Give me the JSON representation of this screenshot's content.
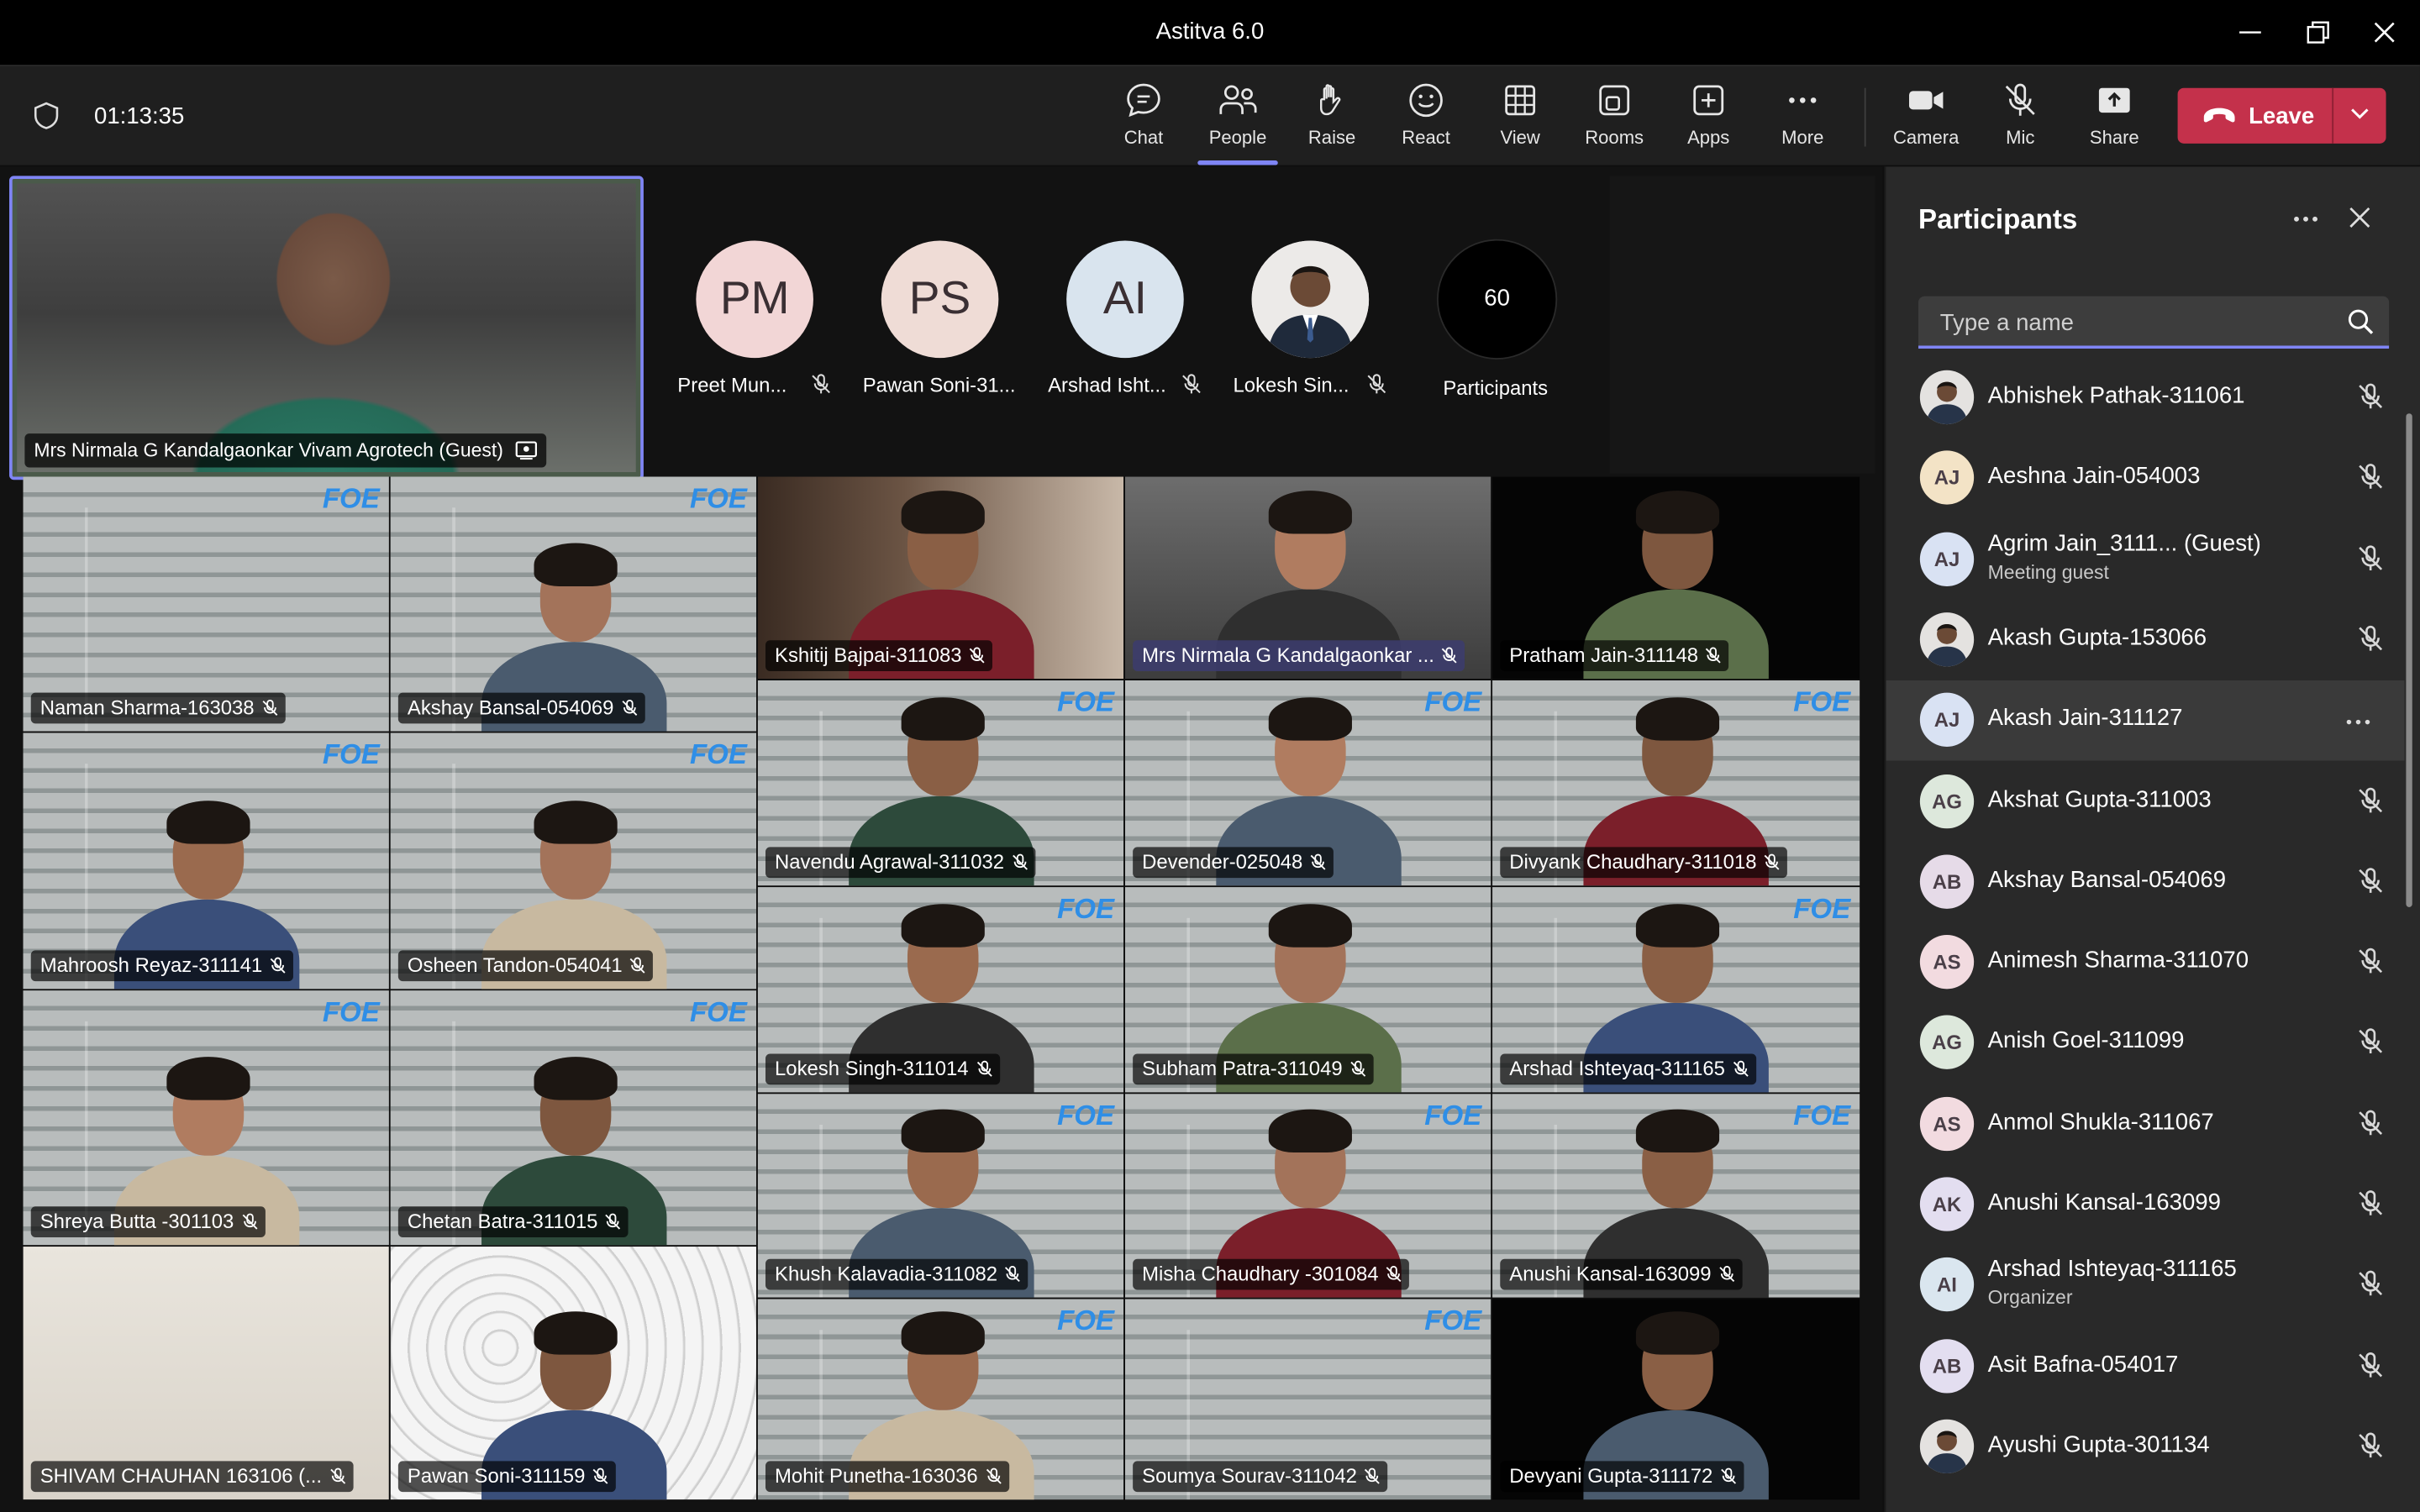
{
  "window": {
    "title": "Astitva 6.0"
  },
  "toolbar": {
    "timer": "01:13:35",
    "buttons": [
      {
        "label": "Chat",
        "icon": "chat-icon"
      },
      {
        "label": "People",
        "icon": "people-icon",
        "active": true
      },
      {
        "label": "Raise",
        "icon": "raise-hand-icon"
      },
      {
        "label": "React",
        "icon": "smile-icon"
      },
      {
        "label": "View",
        "icon": "grid-icon"
      },
      {
        "label": "Rooms",
        "icon": "rooms-icon"
      },
      {
        "label": "Apps",
        "icon": "add-square-icon"
      },
      {
        "label": "More",
        "icon": "ellipsis-icon"
      },
      {
        "label": "Camera",
        "icon": "camera-icon"
      },
      {
        "label": "Mic",
        "icon": "mic-off-icon"
      },
      {
        "label": "Share",
        "icon": "share-icon"
      }
    ],
    "leave_label": "Leave",
    "leave_color": "#c4314b",
    "accent": "#7f85f5"
  },
  "stage": {
    "featured_name": "Mrs Nirmala G Kandalgaonkar Vivam Agrotech (Guest)",
    "strip": [
      {
        "initials": "PM",
        "name": "Preet Mun...",
        "color": "#f2d6d6"
      },
      {
        "initials": "PS",
        "name": "Pawan Soni-31...",
        "color": "#efdcd6"
      },
      {
        "initials": "AI",
        "name": "Arshad Isht...",
        "color": "#d9e4ee"
      },
      {
        "initials": "",
        "name": "Lokesh Sin...",
        "color": "#e8e8e8"
      }
    ],
    "participant_count": "60",
    "participant_label": "Participants",
    "tiles": [
      "Naman Sharma-163038",
      "Akshay Bansal-054069",
      "Kshitij Bajpai-311083",
      "Mrs Nirmala G Kandalgaonkar ...",
      "Pratham Jain-311148",
      "Mahroosh Reyaz-311141",
      "Osheen Tandon-054041",
      "Navendu Agrawal-311032",
      "Devender-025048",
      "Divyank Chaudhary-311018",
      "Lokesh Singh-311014",
      "Subham Patra-311049",
      "Arshad Ishteyaq-311165",
      "Shreya Butta -301103",
      "Chetan Batra-311015",
      "Khush Kalavadia-311082",
      "Misha Chaudhary -301084",
      "Anushi Kansal-163099",
      "SHIVAM CHAUHAN 163106 (...",
      "Pawan Soni-311159",
      "Mohit Punetha-163036",
      "Soumya Sourav-311042",
      "Devyani Gupta-311172"
    ],
    "logo_text": "FOE"
  },
  "panel": {
    "title": "Participants",
    "search_placeholder": "Type a name",
    "participants": [
      {
        "initials": "",
        "name": "Abhishek Pathak-311061",
        "photo": true
      },
      {
        "initials": "AJ",
        "name": "Aeshna Jain-054003",
        "color": "#f3e3c6"
      },
      {
        "initials": "AJ",
        "name": "Agrim Jain_3111... (Guest)",
        "sub": "Meeting guest",
        "color": "#d9e2f3"
      },
      {
        "initials": "",
        "name": "Akash Gupta-153066",
        "photo": true
      },
      {
        "initials": "AJ",
        "name": "Akash Jain-311127",
        "color": "#d9e2f3",
        "hover": true
      },
      {
        "initials": "AG",
        "name": "Akshat Gupta-311003",
        "color": "#dde8dc"
      },
      {
        "initials": "AB",
        "name": "Akshay Bansal-054069",
        "color": "#e6dbe8"
      },
      {
        "initials": "AS",
        "name": "Animesh Sharma-311070",
        "color": "#f2dbe0"
      },
      {
        "initials": "AG",
        "name": "Anish Goel-311099",
        "color": "#dde8dc"
      },
      {
        "initials": "AS",
        "name": "Anmol Shukla-311067",
        "color": "#f2dbe0"
      },
      {
        "initials": "AK",
        "name": "Anushi Kansal-163099",
        "color": "#e3def0"
      },
      {
        "initials": "AI",
        "name": "Arshad Ishteyaq-311165",
        "sub": "Organizer",
        "color": "#dae6ef"
      },
      {
        "initials": "AB",
        "name": "Asit Bafna-054017",
        "color": "#e3def0"
      },
      {
        "initials": "",
        "name": "Ayushi Gupta-301134",
        "photo": true
      }
    ]
  }
}
